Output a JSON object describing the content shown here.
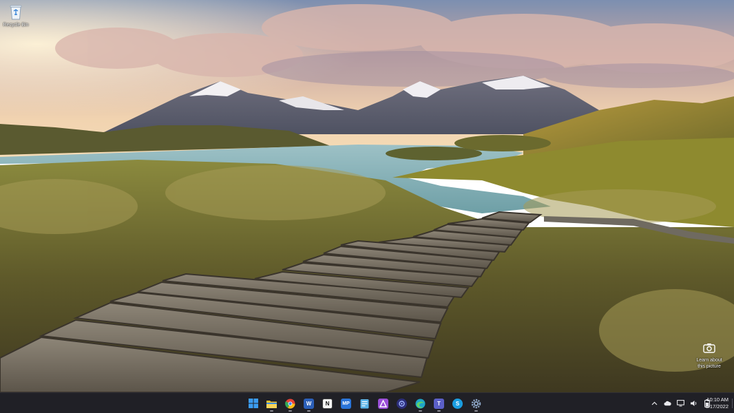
{
  "desktop": {
    "icons": [
      {
        "label": "Recycle Bin",
        "icon": "recycle-bin-icon"
      }
    ],
    "spotlight": {
      "label_line1": "Learn about",
      "label_line2": "this picture",
      "icon": "camera-icon"
    }
  },
  "taskbar": {
    "apps": [
      {
        "name": "Start",
        "icon": "windows-start-icon",
        "color": "#3b9cf0"
      },
      {
        "name": "File Explorer",
        "icon": "folder-icon",
        "color": "#f2c230"
      },
      {
        "name": "Google Chrome",
        "icon": "chrome-icon",
        "color": "#e94235"
      },
      {
        "name": "Microsoft Word",
        "icon": "word-icon",
        "color": "#2b5fb8",
        "glyph": "W"
      },
      {
        "name": "Notion",
        "icon": "notion-icon",
        "color": "#f4f4f4",
        "glyph": "N"
      },
      {
        "name": "MP",
        "icon": "mp-icon",
        "color": "#2a74d8",
        "glyph": "MP"
      },
      {
        "name": "Notepad",
        "icon": "notepad-icon",
        "color": "#5bb4e8"
      },
      {
        "name": "App",
        "icon": "triangle-app-icon",
        "color": "#9b4fd8"
      },
      {
        "name": "Camera",
        "icon": "lens-app-icon",
        "color": "#2c2e7a"
      },
      {
        "name": "Microsoft Edge",
        "icon": "edge-icon",
        "color": "#1fa5c9"
      },
      {
        "name": "Microsoft Teams",
        "icon": "teams-icon",
        "color": "#5b5fc7",
        "glyph": "T"
      },
      {
        "name": "Skype",
        "icon": "skype-icon",
        "color": "#1a9de0",
        "glyph": "S"
      },
      {
        "name": "Settings",
        "icon": "gear-icon",
        "color": "#8aa3c2"
      }
    ],
    "tray": [
      {
        "icon": "chevron-up-icon",
        "glyph": "⌃"
      },
      {
        "icon": "cloud-icon",
        "glyph": "☁"
      },
      {
        "icon": "monitor-icon",
        "glyph": "▭"
      },
      {
        "icon": "speaker-icon",
        "glyph": "🔈"
      },
      {
        "icon": "battery-icon",
        "glyph": "▮"
      }
    ],
    "time": "10:10 AM",
    "date": "6/17/2022"
  },
  "colors": {
    "taskbar_bg": "#202026",
    "accent": "#3b9cf0"
  }
}
